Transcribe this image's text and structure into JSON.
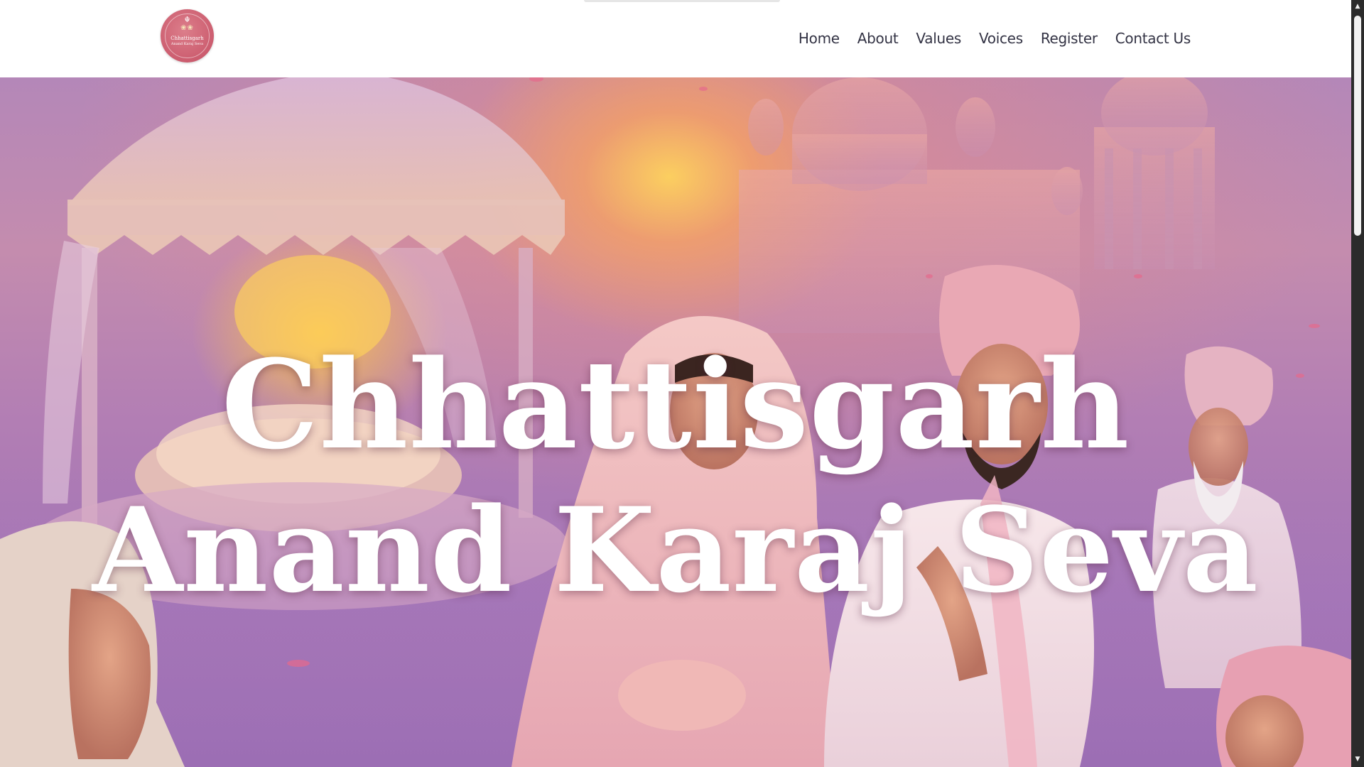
{
  "logo": {
    "khanda": "☬",
    "flowers": "❀❀",
    "line1": "Chhattisgarh",
    "line2": "Anand Karaj Seva"
  },
  "nav": {
    "items": [
      {
        "label": "Home"
      },
      {
        "label": "About"
      },
      {
        "label": "Values"
      },
      {
        "label": "Voices"
      },
      {
        "label": "Register"
      },
      {
        "label": "Contact Us"
      }
    ]
  },
  "hero": {
    "title_line1": "Chhattisgarh",
    "title_line2": "Anand Karaj Seva"
  },
  "scrollbar": {
    "up_icon": "▲",
    "down_icon": "▼"
  },
  "colors": {
    "logo_bg": "#cc5d6f",
    "nav_text": "#333344",
    "hero_title": "#ffffff"
  }
}
